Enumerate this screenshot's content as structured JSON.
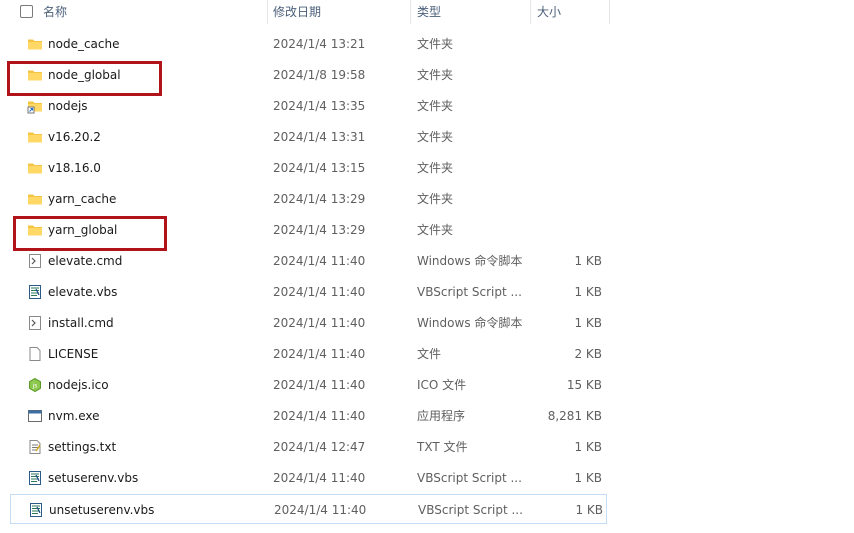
{
  "header": {
    "name": "名称",
    "date": "修改日期",
    "type": "类型",
    "size": "大小"
  },
  "files": [
    {
      "name": "node_cache",
      "date": "2024/1/4 13:21",
      "type": "文件夹",
      "size": "",
      "icon": "folder-icon"
    },
    {
      "name": "node_global",
      "date": "2024/1/8 19:58",
      "type": "文件夹",
      "size": "",
      "icon": "folder-icon"
    },
    {
      "name": "nodejs",
      "date": "2024/1/4 13:35",
      "type": "文件夹",
      "size": "",
      "icon": "folder-shortcut-icon"
    },
    {
      "name": "v16.20.2",
      "date": "2024/1/4 13:31",
      "type": "文件夹",
      "size": "",
      "icon": "folder-icon"
    },
    {
      "name": "v18.16.0",
      "date": "2024/1/4 13:15",
      "type": "文件夹",
      "size": "",
      "icon": "folder-icon"
    },
    {
      "name": "yarn_cache",
      "date": "2024/1/4 13:29",
      "type": "文件夹",
      "size": "",
      "icon": "folder-icon"
    },
    {
      "name": "yarn_global",
      "date": "2024/1/4 13:29",
      "type": "文件夹",
      "size": "",
      "icon": "folder-icon"
    },
    {
      "name": "elevate.cmd",
      "date": "2024/1/4 11:40",
      "type": "Windows 命令脚本",
      "size": "1 KB",
      "icon": "cmd-file-icon"
    },
    {
      "name": "elevate.vbs",
      "date": "2024/1/4 11:40",
      "type": "VBScript Script ...",
      "size": "1 KB",
      "icon": "vbs-file-icon"
    },
    {
      "name": "install.cmd",
      "date": "2024/1/4 11:40",
      "type": "Windows 命令脚本",
      "size": "1 KB",
      "icon": "cmd-file-icon"
    },
    {
      "name": "LICENSE",
      "date": "2024/1/4 11:40",
      "type": "文件",
      "size": "2 KB",
      "icon": "blank-file-icon"
    },
    {
      "name": "nodejs.ico",
      "date": "2024/1/4 11:40",
      "type": "ICO 文件",
      "size": "15 KB",
      "icon": "ico-file-icon"
    },
    {
      "name": "nvm.exe",
      "date": "2024/1/4 11:40",
      "type": "应用程序",
      "size": "8,281 KB",
      "icon": "exe-file-icon"
    },
    {
      "name": "settings.txt",
      "date": "2024/1/4 12:47",
      "type": "TXT 文件",
      "size": "1 KB",
      "icon": "txt-file-icon"
    },
    {
      "name": "setuserenv.vbs",
      "date": "2024/1/4 11:40",
      "type": "VBScript Script ...",
      "size": "1 KB",
      "icon": "vbs-file-icon"
    },
    {
      "name": "unsetuserenv.vbs",
      "date": "2024/1/4 11:40",
      "type": "VBScript Script ...",
      "size": "1 KB",
      "icon": "vbs-file-icon"
    }
  ],
  "highlighted_rows": [
    "node_global",
    "yarn_global"
  ],
  "selected_row": "unsetuserenv.vbs",
  "colors": {
    "highlight": "#b0141a",
    "folder": "#f4c542",
    "header_text": "#4c607a"
  }
}
